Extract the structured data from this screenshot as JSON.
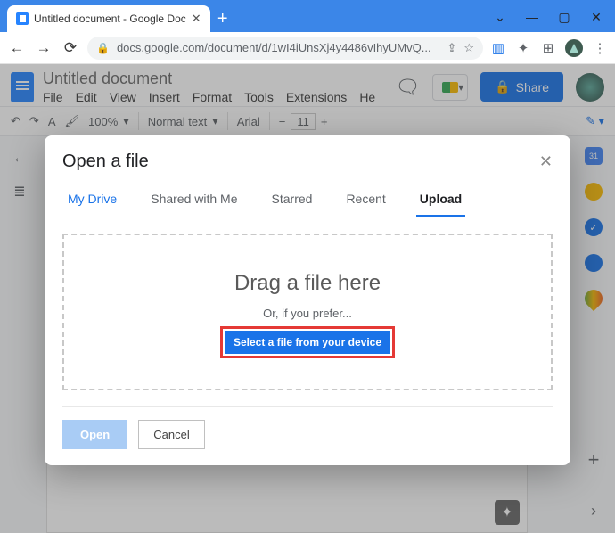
{
  "browser": {
    "tab_title": "Untitled document - Google Doc",
    "url": "docs.google.com/document/d/1wI4iUnsXj4y4486vIhyUMvQ..."
  },
  "docs": {
    "title": "Untitled document",
    "menus": [
      "File",
      "Edit",
      "View",
      "Insert",
      "Format",
      "Tools",
      "Extensions",
      "He"
    ],
    "share_label": "Share",
    "toolbar": {
      "zoom": "100%",
      "style": "Normal text",
      "font": "Arial",
      "font_size": "11"
    }
  },
  "modal": {
    "title": "Open a file",
    "tabs": [
      "My Drive",
      "Shared with Me",
      "Starred",
      "Recent",
      "Upload"
    ],
    "active_tab": "Upload",
    "drag_text": "Drag a file here",
    "or_text": "Or, if you prefer...",
    "select_label": "Select a file from your device",
    "open_label": "Open",
    "cancel_label": "Cancel"
  }
}
